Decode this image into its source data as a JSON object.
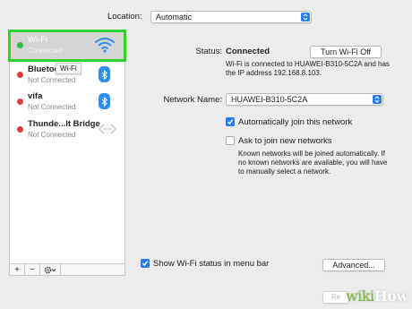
{
  "location": {
    "label": "Location:",
    "value": "Automatic"
  },
  "sidebar": {
    "services": [
      {
        "name": "Wi-Fi",
        "status": "Connected",
        "dot": "#2fbf47",
        "icon": "wifi-icon"
      },
      {
        "name": "Bluetoo",
        "status": "Not Connected",
        "dot": "#e23c3c",
        "icon": "bluetooth-icon"
      },
      {
        "name": "vifa",
        "status": "Not Connected",
        "dot": "#e23c3c",
        "icon": "bluetooth-icon"
      },
      {
        "name": "Thunde...lt Bridge",
        "status": "Not Connected",
        "dot": "#e23c3c",
        "icon": "thunderbolt-bridge-icon"
      }
    ],
    "tooltip": "Wi-Fi",
    "tools": {
      "add": "+",
      "remove": "−",
      "action": "gear-icon"
    }
  },
  "detail": {
    "status_label": "Status:",
    "status_value": "Connected",
    "turn_off_label": "Turn Wi-Fi Off",
    "status_description": "Wi-Fi is connected to HUAWEI-B310-5C2A and has the IP address 192.168.8.103.",
    "network_name_label": "Network Name:",
    "network_name_value": "HUAWEI-B310-5C2A",
    "auto_join_label": "Automatically join this network",
    "auto_join_checked": true,
    "ask_join_label": "Ask to join new networks",
    "ask_join_checked": false,
    "known_networks_desc": "Known networks will be joined automatically. If no known networks are available, you will have to manually select a network.",
    "show_status_label": "Show Wi-Fi status in menu bar",
    "show_status_checked": true,
    "advanced_label": "Advanced...",
    "revert_label": "Re"
  },
  "watermark": {
    "wiki": "wiki",
    "how": "How"
  },
  "colors": {
    "accent": "#2b7cf5",
    "highlight": "#2fd12f",
    "connected": "#2fbf47",
    "disconnected": "#e23c3c"
  }
}
